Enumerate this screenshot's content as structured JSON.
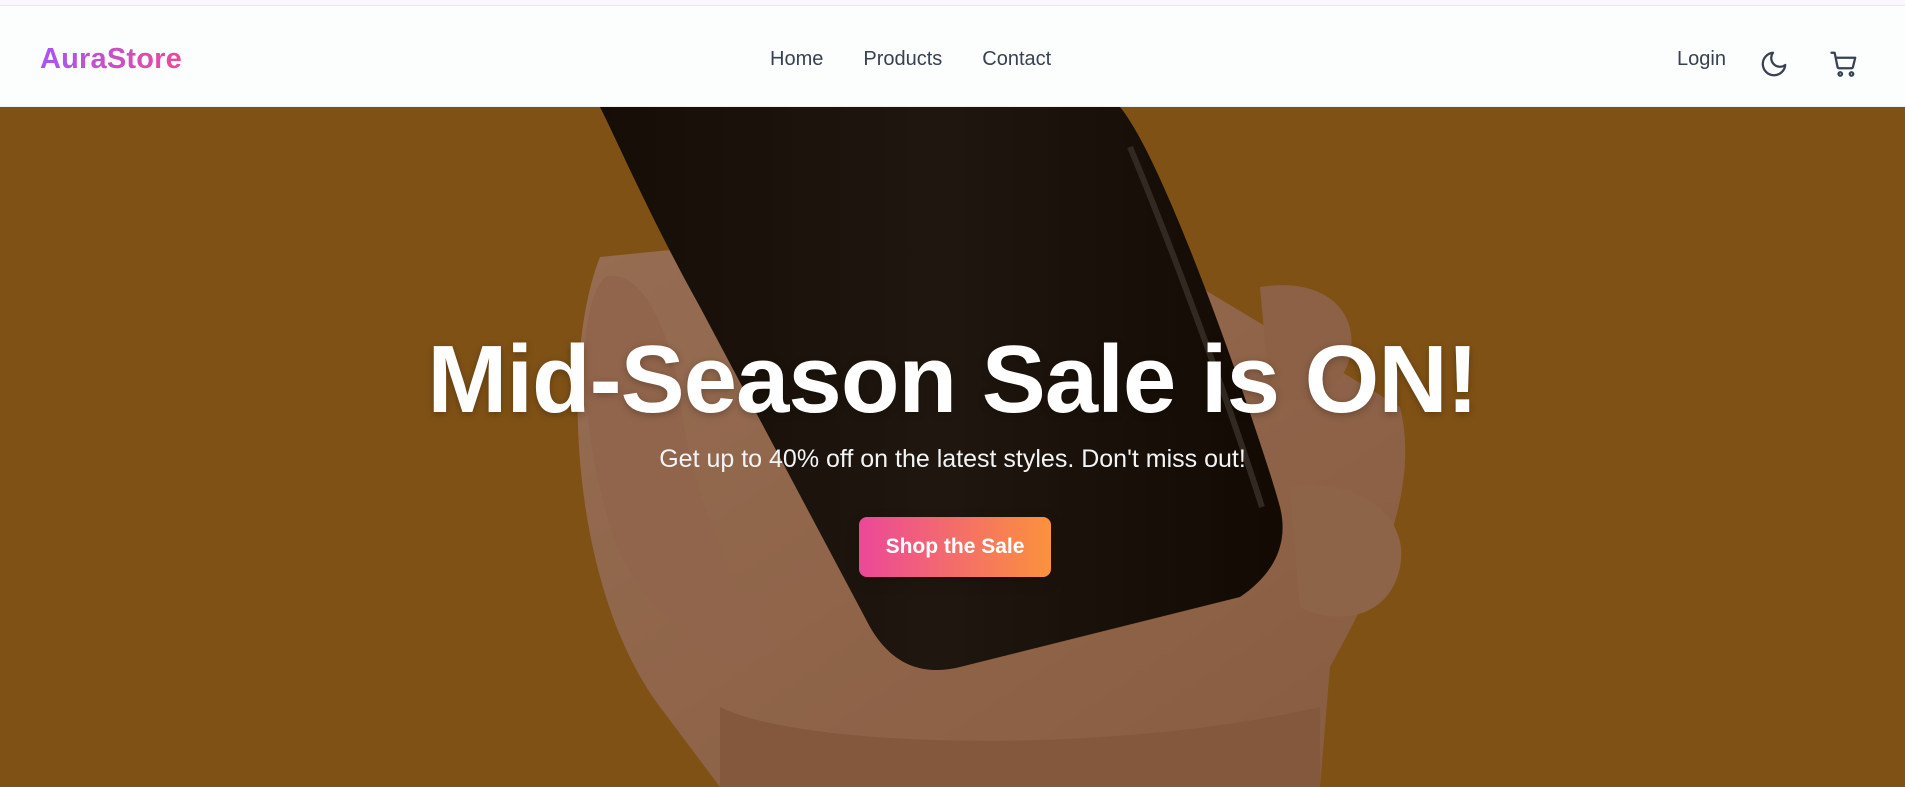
{
  "brand": {
    "name": "AuraStore"
  },
  "nav": {
    "links": [
      {
        "label": "Home"
      },
      {
        "label": "Products"
      },
      {
        "label": "Contact"
      }
    ],
    "login_label": "Login",
    "theme_icon": "moon-icon",
    "cart_icon": "shopping-cart-icon"
  },
  "hero": {
    "title": "Mid-Season Sale is ON!",
    "subtitle": "Get up to 40% off on the latest styles. Don't miss out!",
    "cta_label": "Shop the Sale"
  },
  "colors": {
    "brand_gradient_start": "#a855f7",
    "brand_gradient_end": "#ec4899",
    "cta_gradient_start": "#ec4899",
    "cta_gradient_end": "#fb923c",
    "hero_background": "#b97a23"
  }
}
